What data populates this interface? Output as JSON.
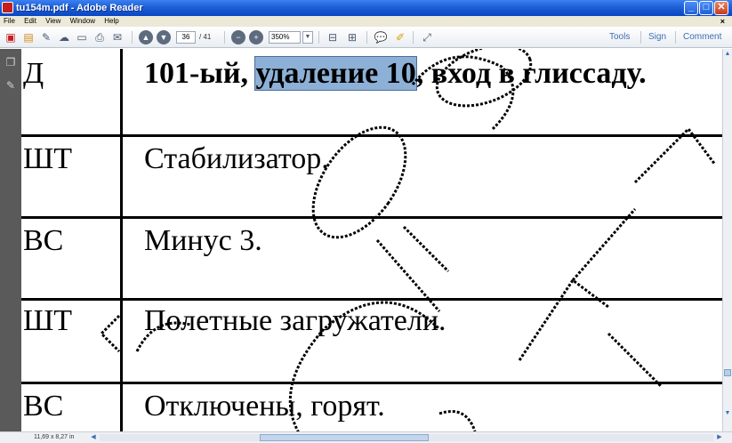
{
  "window": {
    "title": "tu154m.pdf - Adobe Reader",
    "controls": {
      "minimize": "_",
      "maximize": "□",
      "close": "✕"
    },
    "titlebar_color": "#0a46c4"
  },
  "menu": {
    "items": [
      "File",
      "Edit",
      "View",
      "Window",
      "Help"
    ],
    "doc_close": "×"
  },
  "toolbar": {
    "page_current": "36",
    "page_total": "/ 41",
    "zoom": "350%",
    "links": {
      "tools": "Tools",
      "sign": "Sign",
      "comment": "Comment"
    },
    "icons": [
      "create-pdf-icon",
      "open-icon",
      "edit-icon",
      "cloud-icon",
      "save-icon",
      "print-icon",
      "email-icon",
      "previous-page-icon",
      "next-page-icon",
      "zoom-out-icon",
      "zoom-in-icon",
      "zoom-dropdown-icon",
      "fit-width-icon",
      "fit-page-icon",
      "comment-icon",
      "highlight-icon",
      "expand-icon"
    ]
  },
  "nav_pane": {
    "icons": [
      "pages-icon",
      "attachment-icon"
    ]
  },
  "document": {
    "rows": [
      {
        "code": "Д",
        "text_before": "101-ый, ",
        "highlight": "удаление 10",
        "text_after": ", вход в глиссаду.",
        "bold": true
      },
      {
        "code": "ШТ",
        "text": "Стабилизатор."
      },
      {
        "code": "ВС",
        "text": "Минус 3."
      },
      {
        "code": "ШТ",
        "text": "Полетные загружатели."
      },
      {
        "code": "ВС",
        "text": "Отключены, горят."
      }
    ],
    "highlight_color": "#8db0d6"
  },
  "status": {
    "page_size": "11,69 x 8,27 in"
  }
}
